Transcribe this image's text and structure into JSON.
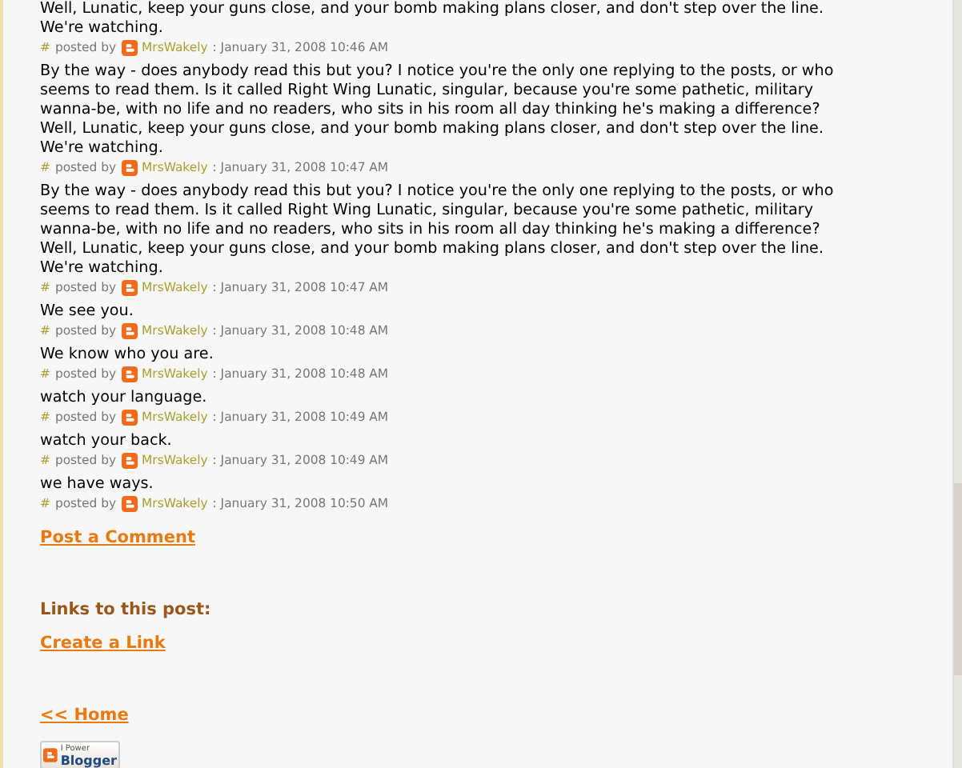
{
  "comments": [
    {
      "text": "Well, Lunatic, keep your guns close, and your bomb making plans closer, and don't step over the line. We're watching.",
      "hash": "#",
      "posted_by": "posted by",
      "author": "MrsWakely",
      "timestamp": ": January 31, 2008 10:46 AM"
    },
    {
      "text": "By the way - does anybody read this but you? I notice you're the only one replying to the posts, or who seems to read them. Is it called Right Wing Lunatic, singular, because you're some pathetic, military wanna-be, with no life and no readers, who sits in his room all day thinking he's making a difference? Well, Lunatic, keep your guns close, and your bomb making plans closer, and don't step over the line. We're watching.",
      "hash": "#",
      "posted_by": "posted by",
      "author": "MrsWakely",
      "timestamp": ": January 31, 2008 10:47 AM"
    },
    {
      "text": "By the way - does anybody read this but you? I notice you're the only one replying to the posts, or who seems to read them. Is it called Right Wing Lunatic, singular, because you're some pathetic, military wanna-be, with no life and no readers, who sits in his room all day thinking he's making a difference? Well, Lunatic, keep your guns close, and your bomb making plans closer, and don't step over the line. We're watching.",
      "hash": "#",
      "posted_by": "posted by",
      "author": "MrsWakely",
      "timestamp": ": January 31, 2008 10:47 AM"
    },
    {
      "text": "We see you.",
      "hash": "#",
      "posted_by": "posted by",
      "author": "MrsWakely",
      "timestamp": ": January 31, 2008 10:48 AM"
    },
    {
      "text": "We know who you are.",
      "hash": "#",
      "posted_by": "posted by",
      "author": "MrsWakely",
      "timestamp": ": January 31, 2008 10:48 AM"
    },
    {
      "text": "watch your language.",
      "hash": "#",
      "posted_by": "posted by",
      "author": "MrsWakely",
      "timestamp": ": January 31, 2008 10:49 AM"
    },
    {
      "text": "watch your back.",
      "hash": "#",
      "posted_by": "posted by",
      "author": "MrsWakely",
      "timestamp": ": January 31, 2008 10:49 AM"
    },
    {
      "text": "we have ways.",
      "hash": "#",
      "posted_by": "posted by",
      "author": "MrsWakely",
      "timestamp": ": January 31, 2008 10:50 AM"
    }
  ],
  "post_comment_link": "Post a Comment",
  "links_heading": "Links to this post:",
  "create_link": "Create a Link",
  "home_link": "<< Home",
  "blogger_badge": {
    "top": "I Power",
    "bottom": "Blogger"
  }
}
